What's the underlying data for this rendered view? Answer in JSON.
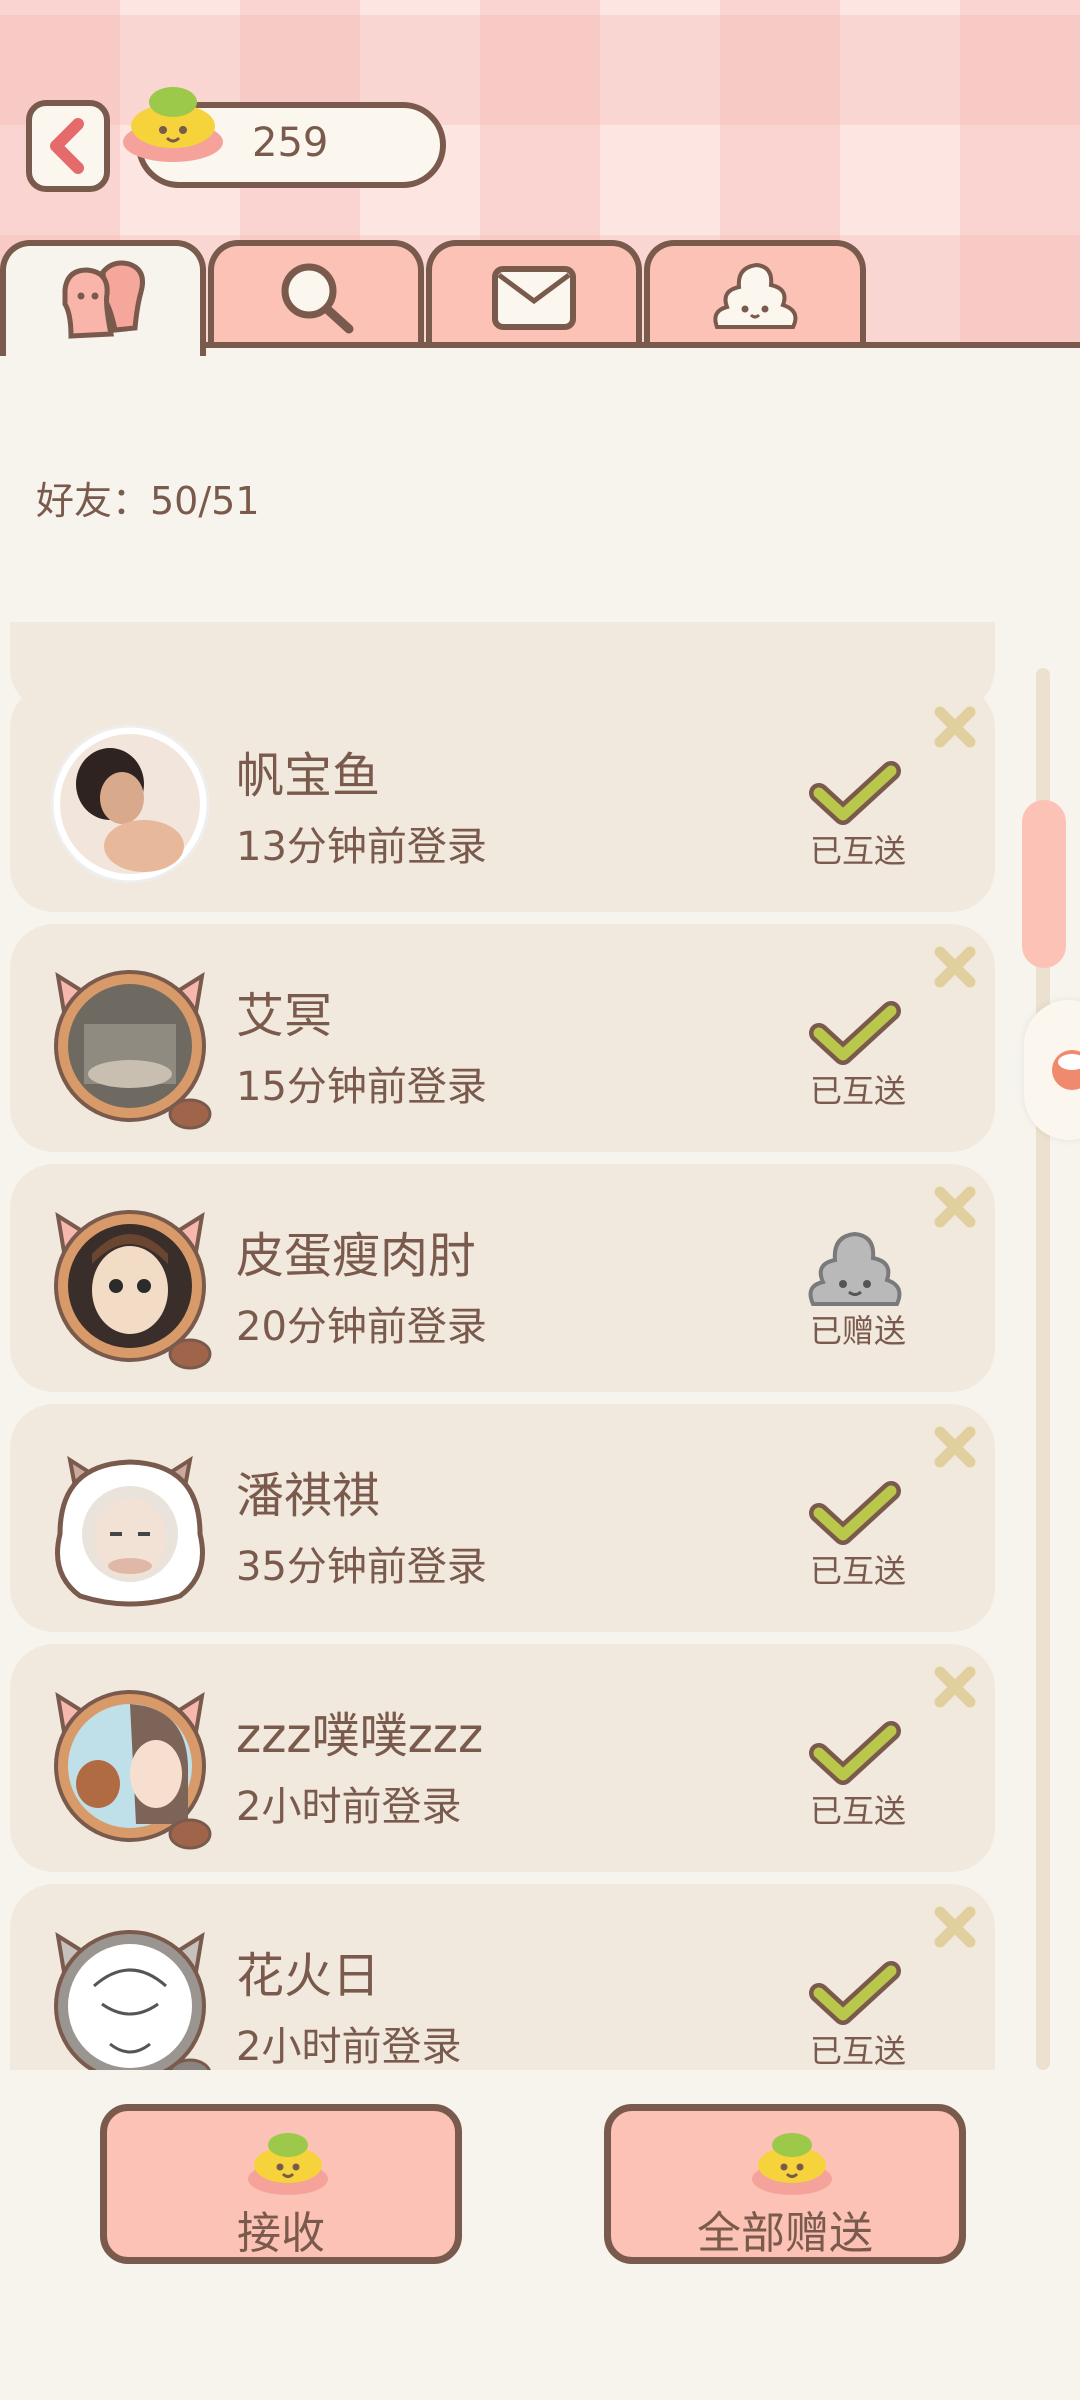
{
  "header": {
    "coin_count": "259"
  },
  "tabs": [
    {
      "icon": "friends-icon"
    },
    {
      "icon": "search-icon"
    },
    {
      "icon": "mail-icon"
    },
    {
      "icon": "poop-icon"
    }
  ],
  "friends_label": "好友：50/51",
  "friends": [
    {
      "name": "帆宝鱼",
      "login": "13分钟前登录",
      "status": "已互送",
      "status_icon": "check-icon",
      "avatar": "photo-avatar"
    },
    {
      "name": "艾冥",
      "login": "15分钟前登录",
      "status": "已互送",
      "status_icon": "check-icon",
      "avatar": "cat-frame-avatar"
    },
    {
      "name": "皮蛋瘦肉肘",
      "login": "20分钟前登录",
      "status": "已赠送",
      "status_icon": "gray-poop-icon",
      "avatar": "cat-frame-avatar"
    },
    {
      "name": "潘祺祺",
      "login": "35分钟前登录",
      "status": "已互送",
      "status_icon": "check-icon",
      "avatar": "panda-hood-avatar"
    },
    {
      "name": "zzz噗噗zzz",
      "login": "2小时前登录",
      "status": "已互送",
      "status_icon": "check-icon",
      "avatar": "cat-frame-avatar"
    },
    {
      "name": "花火日",
      "login": "2小时前登录",
      "status": "已互送",
      "status_icon": "check-icon",
      "avatar": "gray-cat-frame-avatar"
    }
  ],
  "bottom": {
    "receive_label": "接收",
    "give_all_label": "全部赠送"
  },
  "colors": {
    "outline": "#7a5a4c",
    "tab_pink": "#fcc2b6",
    "card": "#f1e9dd",
    "check_green": "#b9c84a",
    "remove_x": "#e2cf9e"
  }
}
